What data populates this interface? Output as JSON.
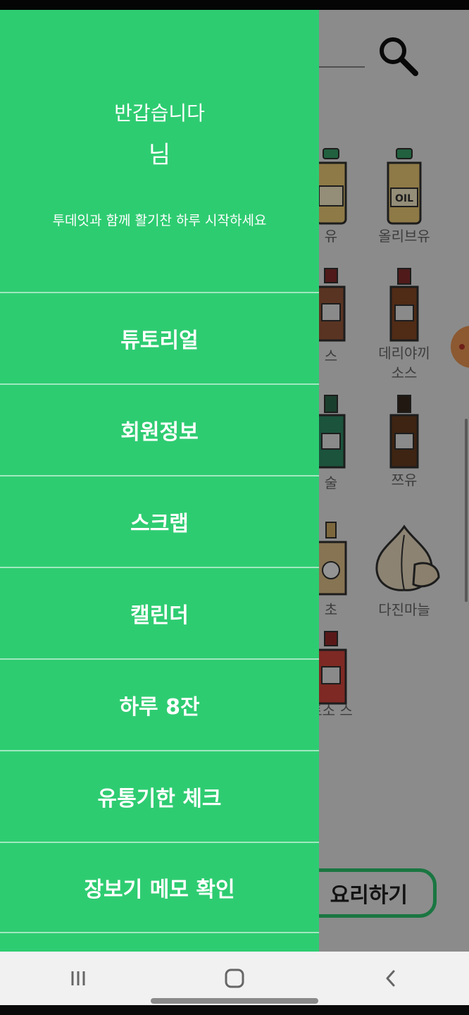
{
  "drawer": {
    "greeting_title": "반갑습니다",
    "greeting_name": "님",
    "greeting_message": "투데잇과 함께 활기찬 하루 시작하세요",
    "menu": [
      {
        "label": "튜토리얼"
      },
      {
        "label": "회원정보"
      },
      {
        "label": "스크랩"
      },
      {
        "label": "캘린더"
      },
      {
        "label": "하루 8잔"
      },
      {
        "label": "유통기한 체크"
      },
      {
        "label": "장보기 메모 확인"
      }
    ]
  },
  "background": {
    "ingredients": [
      {
        "label": "유",
        "icon": "oil-bottle-icon"
      },
      {
        "label": "올리브유",
        "icon": "olive-oil-bottle-icon"
      },
      {
        "label": "스",
        "icon": "sauce-bottle-icon"
      },
      {
        "label": "데리야끼\n소스",
        "icon": "teriyaki-sauce-bottle-icon"
      },
      {
        "label": "술",
        "icon": "liquor-bottle-icon"
      },
      {
        "label": "쯔유",
        "icon": "tsuyu-bottle-icon"
      },
      {
        "label": "초",
        "icon": "vinegar-bottle-icon"
      },
      {
        "label": "다진마늘",
        "icon": "garlic-icon"
      },
      {
        "label": "토소\n스",
        "icon": "tomato-sauce-bottle-icon"
      }
    ],
    "cook_button": "요리하기",
    "colors": {
      "accent": "#2ecc71",
      "dim_overlay": "rgba(0,0,0,0.42)"
    }
  },
  "nav": {
    "recent_icon": "recent-apps-icon",
    "home_icon": "home-icon",
    "back_icon": "back-icon"
  }
}
